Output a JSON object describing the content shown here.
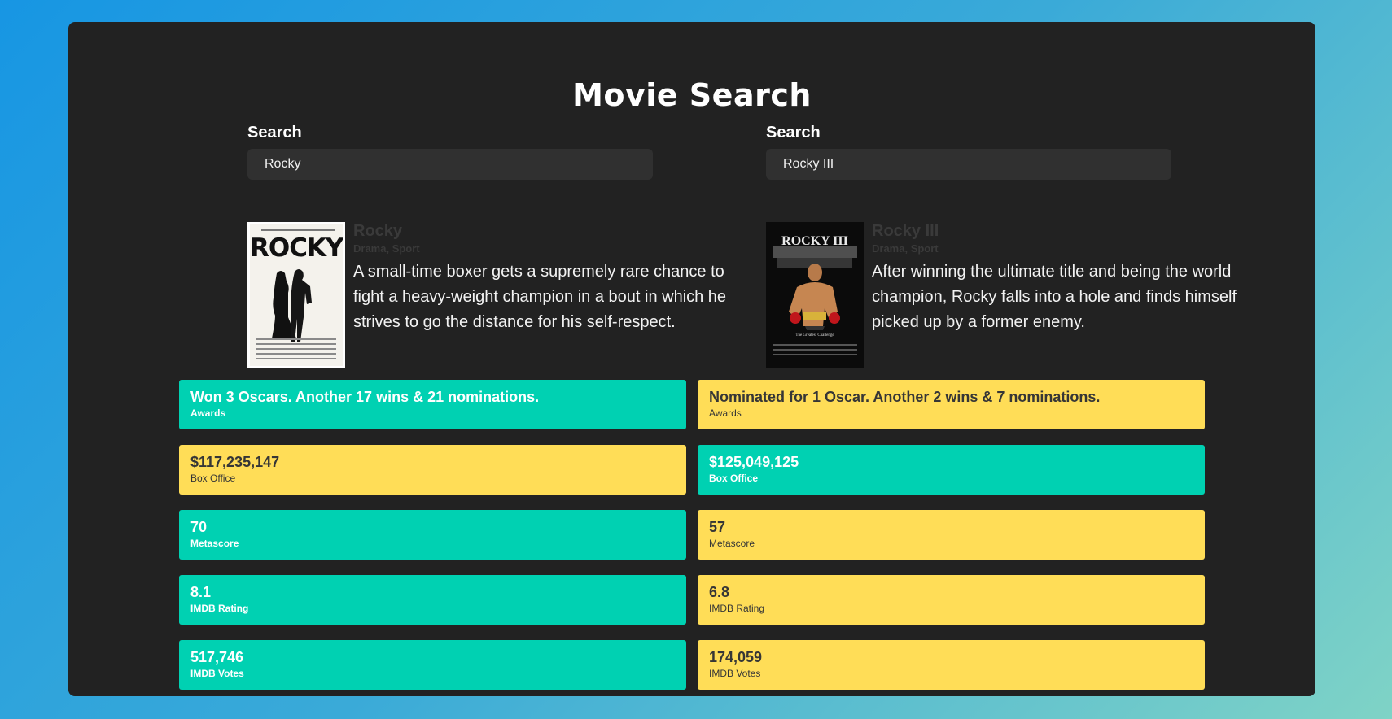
{
  "page": {
    "title": "Movie Search"
  },
  "left": {
    "search": {
      "label": "Search",
      "value": "Rocky"
    },
    "movie": {
      "poster_text": "ROCKY",
      "title": "Rocky",
      "genre": "Drama, Sport",
      "plot": "A small-time boxer gets a supremely rare chance to fight a heavy-weight champion in a bout in which he strives to go the distance for his self-respect."
    },
    "stats": [
      {
        "value": "Won 3 Oscars. Another 17 wins & 21 nominations.",
        "label": "Awards",
        "status": "win"
      },
      {
        "value": "$117,235,147",
        "label": "Box Office",
        "status": "lose"
      },
      {
        "value": "70",
        "label": "Metascore",
        "status": "win"
      },
      {
        "value": "8.1",
        "label": "IMDB Rating",
        "status": "win"
      },
      {
        "value": "517,746",
        "label": "IMDB Votes",
        "status": "win"
      }
    ]
  },
  "right": {
    "search": {
      "label": "Search",
      "value": "Rocky III"
    },
    "movie": {
      "poster_text": "ROCKY III",
      "poster_tagline": "The Greatest Challenge",
      "title": "Rocky III",
      "genre": "Drama, Sport",
      "plot": "After winning the ultimate title and being the world champion, Rocky falls into a hole and finds himself picked up by a former enemy."
    },
    "stats": [
      {
        "value": "Nominated for 1 Oscar. Another 2 wins & 7 nominations.",
        "label": "Awards",
        "status": "lose"
      },
      {
        "value": "$125,049,125",
        "label": "Box Office",
        "status": "win"
      },
      {
        "value": "57",
        "label": "Metascore",
        "status": "lose"
      },
      {
        "value": "6.8",
        "label": "IMDB Rating",
        "status": "lose"
      },
      {
        "value": "174,059",
        "label": "IMDB Votes",
        "status": "lose"
      }
    ]
  },
  "colors": {
    "win": "#00d1b2",
    "lose": "#ffdd57",
    "card": "#222222"
  }
}
